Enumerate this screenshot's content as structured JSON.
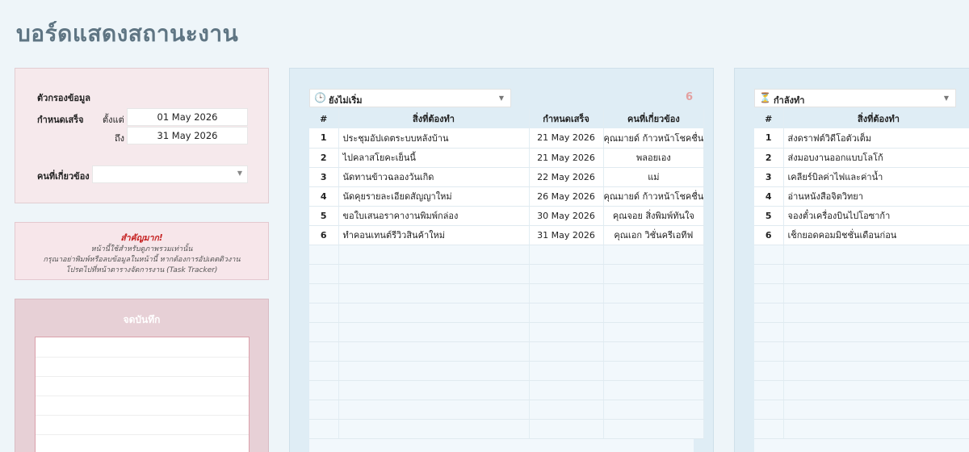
{
  "page_title": "บอร์ดแสดงสถานะงาน",
  "filter": {
    "heading": "ตัวกรองข้อมูล",
    "due_label": "กำหนดเสร็จ",
    "from_label": "ตั้งแต่",
    "from_value": "01 May 2026",
    "to_label": "ถึง",
    "to_value": "31 May 2026",
    "people_label": "คนที่เกี่ยวข้อง",
    "people_value": ""
  },
  "notice": {
    "important": "สำคัญมาก!",
    "line1": "หน้านี้ใช้สำหรับดูภาพรวมเท่านั้น",
    "line2": "กรุณาอย่าพิมพ์หรือลบข้อมูลในหน้านี้ หากต้องการอัปเดตดิวงาน",
    "line3": "โปรดไปที่หน้าตารางจัดการงาน (Task Tracker)"
  },
  "notes": {
    "title": "จดบันทึก"
  },
  "columns": {
    "num": "#",
    "task": "สิ่งที่ต้องทำ",
    "due": "กำหนดเสร็จ",
    "people": "คนที่เกี่ยวข้อง"
  },
  "not_started": {
    "status": "ยังไม่เริ่ม",
    "icon": "clock-icon",
    "count": "6",
    "count_color": "#e3a0a0",
    "rows": [
      {
        "num": "1",
        "task": "ประชุมอัปเดตระบบหลังบ้าน",
        "due": "21 May 2026",
        "people": "คุณมายด์ ก้าวหน้าโชคชื่น"
      },
      {
        "num": "2",
        "task": "ไปคลาสโยคะเย็นนี้",
        "due": "21 May 2026",
        "people": "พลอยเอง"
      },
      {
        "num": "3",
        "task": "นัดทานข้าวฉลองวันเกิด",
        "due": "22 May 2026",
        "people": "แม่"
      },
      {
        "num": "4",
        "task": "นัดคุยรายละเอียดสัญญาใหม่",
        "due": "26 May 2026",
        "people": "คุณมายด์ ก้าวหน้าโชคชื่น"
      },
      {
        "num": "5",
        "task": "ขอใบเสนอราคางานพิมพ์กล่อง",
        "due": "30 May 2026",
        "people": "คุณจอย สิ่งพิมพ์ทันใจ"
      },
      {
        "num": "6",
        "task": "ทำคอนเทนต์รีวิวสินค้าใหม่",
        "due": "31 May 2026",
        "people": "คุณเอก วิชั่นครีเอทีฟ"
      }
    ]
  },
  "in_progress": {
    "status": "กำลังทำ",
    "icon": "hourglass-icon",
    "rows": [
      {
        "num": "1",
        "task": "ส่งดราฟต์วิดีโอตัวเต็ม"
      },
      {
        "num": "2",
        "task": "ส่งมอบงานออกแบบโลโก้"
      },
      {
        "num": "3",
        "task": "เคลียร์บิลค่าไฟและค่าน้ำ"
      },
      {
        "num": "4",
        "task": "อ่านหนังสือจิตวิทยา"
      },
      {
        "num": "5",
        "task": "จองตั๋วเครื่องบินไปโอซาก้า"
      },
      {
        "num": "6",
        "task": "เช็กยอดคอมมิชชั่นเดือนก่อน"
      }
    ]
  }
}
